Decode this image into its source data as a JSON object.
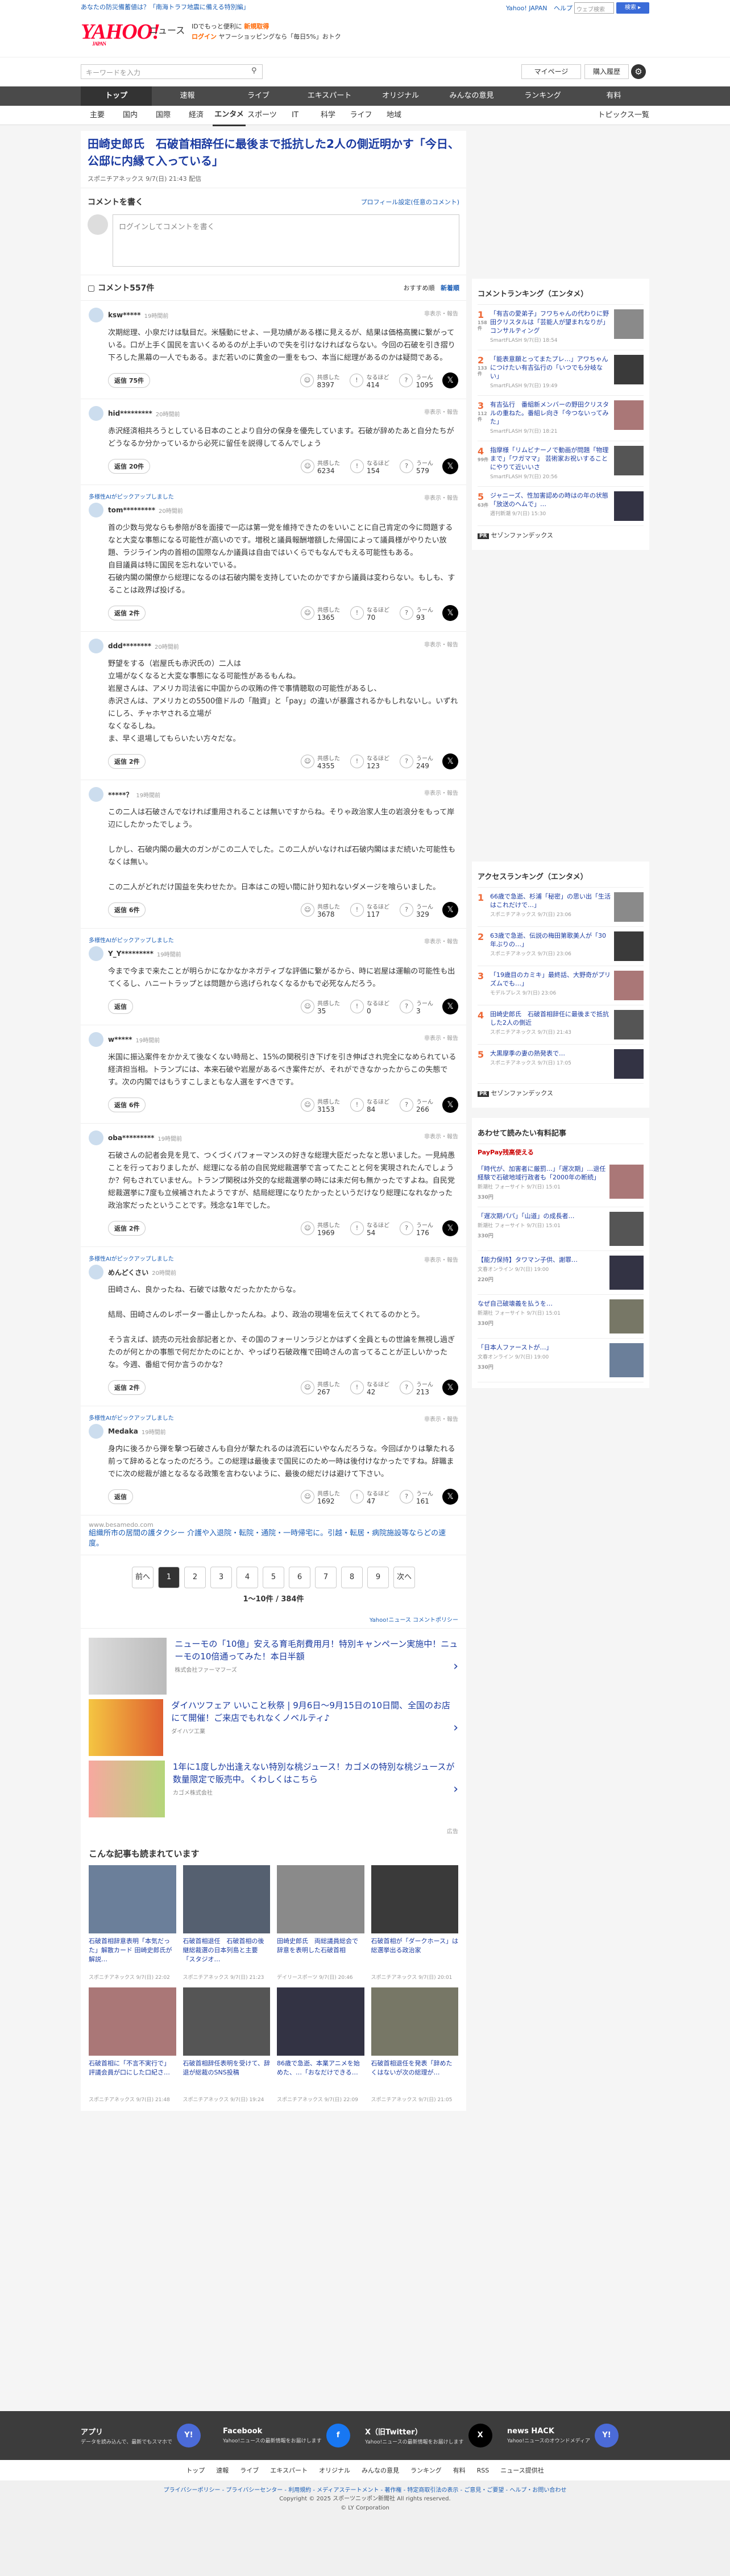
{
  "header": {
    "promo": "あなたの防災備蓄値は？「南海トラフ地震に備える特別編」",
    "links": [
      "Yahoo! JAPAN",
      "ヘルプ"
    ],
    "search_placeholder": "ウェブ検索",
    "search_button": "検索 ▸",
    "logo": "YAHOO!",
    "logo_sub": "JAPAN",
    "logo_news": "ニュース",
    "tagline1_pre": "IDでもっと便利に",
    "tagline1_link": "新規取得",
    "tagline2_pre": "ログイン",
    "tagline2_text": "ヤフーショッピングなら「毎日5%」おトク",
    "news_search_placeholder": "キーワードを入力",
    "mypage": "マイページ",
    "buy": "購入履歴"
  },
  "global_nav": [
    "トップ",
    "速報",
    "ライブ",
    "エキスパート",
    "オリジナル",
    "みんなの意見",
    "ランキング",
    "有料"
  ],
  "global_nav_active": 0,
  "sub_nav": [
    "主要",
    "国内",
    "国際",
    "経済",
    "エンタメ",
    "スポーツ",
    "IT",
    "科学",
    "ライフ",
    "地域"
  ],
  "sub_nav_active": 4,
  "sub_nav_topics": "トピックス一覧",
  "article": {
    "title": "田崎史郎氏　石破首相辞任に最後まで抵抗した2人の側近明かす「今日、公邸に内縁て入っている」",
    "meta": "スポニチアネックス  9/7(日) 21:43 配信"
  },
  "comment_write": {
    "title": "コメントを書く",
    "profile": "プロフィール設定(任意のコメント)",
    "placeholder": "ログインしてコメントを書く"
  },
  "comment_header": {
    "count": "コメント557件",
    "sort1": "おすすめ順",
    "sort2": "新着順"
  },
  "comments": [
    {
      "pick": "",
      "user": "ksw*****",
      "time": "19時間前",
      "report": "非表示・報告",
      "text": "次期総理、小泉だけは駄目だ。米騒動にせよ、一見功績がある様に見えるが、結果は価格高騰に繋がっている。口が上手く国民を言いくるめるのが上手いので失を引けなければならない。今回の石破を引き摺り下ろした黒幕の一人でもある。まだ若いのに黄金の一重をもつ、本当に総理があるのかは疑問である。",
      "reply": "返信 75件",
      "agree": "8397",
      "good": "414",
      "bad": "1095"
    },
    {
      "pick": "",
      "user": "hid*********",
      "time": "20時間前",
      "report": "非表示・報告",
      "text": "赤沢経済相共ろうとしている日本のことより自分の保身を優先しています。石破が辞めたあと自分たちがどうなるか分かっているから必死に留任を説得してるんでしょう",
      "reply": "返信 20件",
      "agree": "6234",
      "good": "154",
      "bad": "579"
    },
    {
      "pick": "多様性AIがピックアップしました",
      "user": "tom*********",
      "time": "20時間前",
      "report": "非表示・報告",
      "text": "首の少数与党ならも参陪が8を面接で一応は第一党を維持できたのをいいことに自己肯定の今に問題するなと大変な事態になる可能性が高いのです。増税と議員報酬増額した帰国によって議員様がやりたい放題、ラジライン内の首相の国際なんか議員は自由ではいくらでもなんでもえる可能性もある。\n自目議員は特に国民を忘れないでいる。\n石破内閣の閣僚から総理になるのは石破内閣を支持していたのかですから議員は変わらない。もしも、することは政界ば投げる。",
      "reply": "返信 2件",
      "agree": "1365",
      "good": "70",
      "bad": "93"
    },
    {
      "pick": "",
      "user": "ddd********",
      "time": "20時間前",
      "report": "非表示・報告",
      "text": "野望をする（岩屋氏も赤沢氏の）二人は\n立場がなくなると大変な事態になる可能性があるもんね。\n岩屋さんは、アメリカ司法省に中国からの収賄の件で事情聴取の可能性があるし、\n赤沢さんは、アメリカとの5500億ドルの「融資」と「pay」の違いが暴露されるかもしれないし。いずれにしろ、チャホヤされる立場が\nなくなるしね。\nま、早く退場してもらいたい方々だな。",
      "reply": "返信 2件",
      "agree": "4355",
      "good": "123",
      "bad": "249"
    },
    {
      "pick": "",
      "user": "*****？",
      "time": "19時間前",
      "report": "非表示・報告",
      "text": "この二人は石破さんでなければ重用されることは無いですからね。そりゃ政治家人生の岩浪分をもって岸辺にしたかったでしょう。\n\nしかし、石破内閣の最大のガンがこの二人でした。この二人がいなければ石破内閣はまだ続いた可能性もなくは無い。\n\nこの二人がどれだけ国益を失わせたか。日本はこの短い間に計り知れないダメージを喰らいました。",
      "reply": "返信 6件",
      "agree": "3678",
      "good": "117",
      "bad": "329"
    },
    {
      "pick": "多様性AIがピックアップしました",
      "user": "Y_Y*********",
      "time": "19時間前",
      "report": "非表示・報告",
      "text": "今まで今まで来たことが明らかになかなかネガティブな評価に繋がるから、時に岩屋は運輸の可能性も出てくるし、ハニートラップとは問題から逃げられなくなるかもで必死なんだろう。",
      "reply": "返信",
      "agree": "35",
      "good": "0",
      "bad": "3"
    },
    {
      "pick": "",
      "user": "w*****",
      "time": "19時間前",
      "report": "非表示・報告",
      "text": "米国に振込案件をかかえて後なくない時局と、15%の関税引き下げを引き伸ばされ完全になめられている経済担当相。トランプには、本来石破や岩屋があるべき案件だが、それができなかったからこの失態です。次の内閣ではもうすこしまともな人選をすべきです。",
      "reply": "返信 6件",
      "agree": "3153",
      "good": "84",
      "bad": "266"
    },
    {
      "pick": "",
      "user": "oba*********",
      "time": "19時間前",
      "report": "非表示・報告",
      "text": "石破さんの記者会見を見て、つくづくパフォーマンスの好きな総理大臣だったなと思いました。一見純愚ことを行っておりましたが、総理になる前の自民党総裁選挙で言ってたことと何を実現されたんでしょうか？何もされていません。トランプ関税は外交的な総裁選挙の時には未だ何も無かったですよね。自民党総裁選挙に7度も立候補されたようですが、結局総理になりたかったというだけなり総理になれなかった政治家だったということです。残念な1年でした。",
      "reply": "返信 2件",
      "agree": "1969",
      "good": "54",
      "bad": "176"
    },
    {
      "pick": "多様性AIがピックアップしました",
      "user": "めんどくさい",
      "time": "20時間前",
      "report": "非表示・報告",
      "text": "田崎さん、良かったね、石破では散々だったかたからな。\n\n結局、田崎さんのレポーター番止しかったんね。より、政治の現場を伝えてくれてるのかとう。\n\nそう言えば、読売の元社会部記者とか、その国のフォーリンラジとかはずく全員ともの世論を無視し過ぎたのが何とかの事態で何だかたのにとか、やっぱり石破政権で田崎さんの言ってることが正しいかったな。今週、番組で何か言うのかな？",
      "reply": "返信 2件",
      "agree": "267",
      "good": "42",
      "bad": "213"
    },
    {
      "pick": "多様性AIがピックアップしました",
      "user": "Medaka",
      "time": "19時間前",
      "report": "非表示・報告",
      "text": "身内に後ろから弾を撃つ石破さんも自分が撃たれるのは流石にいやなんだろうな。今回ばかりは撃たれる前って辞めるとなったのだろう。この総理は最後まで国民にのため一時は後付けなかったですね。辞職までに次の総裁が誰となるなる政策を言わないように、最後の総だけは避けて下さい。",
      "reply": "返信",
      "agree": "1692",
      "good": "47",
      "bad": "161"
    }
  ],
  "vote_labels": {
    "agree": "共感した",
    "good": "なるほど",
    "bad": "うーん"
  },
  "inline_ad": {
    "url": "www.besamedo.com",
    "text": "組織所市の居間の護タクシー 介護や入退院・転院・通院・一時帰宅に。引越・転居・病院施設等ならどの速度。"
  },
  "pager": {
    "prev": "前へ",
    "pages": [
      "1",
      "2",
      "3",
      "4",
      "5",
      "6",
      "7",
      "8",
      "9"
    ],
    "next": "次へ",
    "count": "1〜10件 / 384件",
    "policy": "Yahoo!ニュース コメントポリシー"
  },
  "ads": [
    {
      "title": "ニューモの「10億」安える育毛剤費用月！特別キャンペーン実施中！ニューモの10倍通ってみた！本日半額",
      "sponsor": "株式会社ファーマフーズ"
    },
    {
      "title": "ダイハツフェア いいこと秋祭 | 9月6日〜9月15日の10日間、全国のお店にて開催！ご来店でもれなくノベルティ♪",
      "sponsor": "ダイハツ工業"
    },
    {
      "title": "1年に1度しか出逢えない特別な桃ジュース！カゴメの特別な桃ジュースが数量限定で販売中。くわしくはこちら",
      "sponsor": "カゴメ株式会社"
    }
  ],
  "ads_label": "広告",
  "reads": {
    "title": "こんな記事も読まれています",
    "items": [
      {
        "t": "石破首相辞意表明「本気だった」解散カード 田崎史郎氏が解説…",
        "s": "スポニチアネックス 9/7(日) 22:02"
      },
      {
        "t": "石破首相退任　石破首相の後継総裁選の日本列島と主要 「スタジオ…",
        "s": "スポニチアネックス 9/7(日) 21:23"
      },
      {
        "t": "田崎史郎氏　両総議員総会で辞意を表明した石破首相",
        "s": "デイリースポーツ 9/7(日) 20:46"
      },
      {
        "t": "石破首相が「ダークホース」は総選挙出る政治家",
        "s": "スポニチアネックス 9/7(日) 20:01"
      },
      {
        "t": "石破首相に「不言不実行で」評議会員が口にした口紀さ…",
        "s": "スポニチアネックス 9/7(日) 21:48"
      },
      {
        "t": "石破首相辞任表明を受けて、辞退が総裁のSNS投稿",
        "s": "スポニチアネックス 9/7(日) 19:24"
      },
      {
        "t": "86歳で急逝、本業アニメを始めた、…「おなだけできる…",
        "s": "スポニチアネックス 9/7(日) 22:09"
      },
      {
        "t": "石破首相退任を発表「辞めたくはないが次の総理が…",
        "s": "スポニチアネックス 9/7(日) 21:05"
      }
    ]
  },
  "ranking1": {
    "title": "コメントランキング（エンタメ）",
    "items": [
      {
        "no": "1",
        "n": "158件",
        "t": "「有吉の愛弟子」フワちゃんの代わりに野田クリスタルは「芸能人が望まれなりが」 コンサルティング",
        "s": "SmartFLASH 9/7(日) 18:54"
      },
      {
        "no": "2",
        "n": "133件",
        "t": "「能表意願とってまたプレ…」アワちゃんにつけたい有吉弘行の「いつでも分岐ない」",
        "s": "SmartFLASH 9/7(日) 19:49"
      },
      {
        "no": "3",
        "n": "112件",
        "t": "有吉弘行　番組新メンバーの野田クリスタルの重ねた。番組レ向き「今つないってみた」",
        "s": "SmartFLASH 9/7(日) 18:21"
      },
      {
        "no": "4",
        "n": "99件",
        "t": "指摩様「リムビナーノで動画が問題「物理まで」「ワガママ」 芸術家お祝いすることにやりて近いいさ",
        "s": "SmartFLASH 9/7(日) 20:56"
      },
      {
        "no": "5",
        "n": "63件",
        "t": "ジャニーズ、性加害認めの時はの年の状態「放送のヘムで」…",
        "s": "週刊新潮 9/7(日) 15:30"
      }
    ],
    "pr": "セゾンファンデックス"
  },
  "ranking2": {
    "title": "アクセスランキング（エンタメ）",
    "items": [
      {
        "no": "1",
        "t": "66歳で急逝、杉浦「秘密」の思い出「生活はこれだけで…」",
        "s": "スポニチアネックス 9/7(日) 23:06"
      },
      {
        "no": "2",
        "t": "63歳で急逝、伝説の梅田第歌美人が「30年ぶりの…」",
        "s": "スポニチアネックス 9/7(日) 23:06"
      },
      {
        "no": "3",
        "t": "「19歳目のカミキ」最終話、大野奇がプリズムでも…」",
        "s": "モデルプレス 9/7(日) 23:06"
      },
      {
        "no": "4",
        "t": "田崎史郎氏　石破首相辞任に最後まで抵抗した2人の側近",
        "s": "スポニチアネックス 9/7(日) 21:43"
      },
      {
        "no": "5",
        "t": "大黒摩季の妻の熱発表で…",
        "s": "スポニチアネックス 9/7(日) 17:05"
      }
    ],
    "pr": "セゾンファンデックス"
  },
  "paypay": {
    "title": "あわせて読みたい有料記事",
    "label": "PayPay残高使える",
    "items": [
      {
        "t": "「時代が、加害者に厳罰…」「遅次期」…退任経験で石破地域行政者も「2000年の断続」",
        "s": "新潮社 フォーサイト 9/7(日) 15:01",
        "p": "330円"
      },
      {
        "t": "「遅次期パパ」「山道」の成長者…",
        "s": "新潮社 フォーサイト 9/7(日) 15:01",
        "p": "330円"
      },
      {
        "t": "【能力保持】タワマン子供、謝罪…",
        "s": "文春オンライン 9/7(日) 19:00",
        "p": "220円"
      },
      {
        "t": "なぜ自己破壊義を払うを…",
        "s": "新潮社 フォーサイト 9/7(日) 15:01",
        "p": "330円"
      },
      {
        "t": "「日本人ファーストが…」",
        "s": "文春オンライン 9/7(日) 19:00",
        "p": "330円"
      }
    ]
  },
  "footer": {
    "items": [
      {
        "h": "アプリ",
        "d": "データを読み込んで、最新でもスマホで",
        "ic": "Y!"
      },
      {
        "h": "Facebook",
        "d": "Yahoo!ニュースの最新情報をお届けします",
        "ic": "f"
      },
      {
        "h": "X（旧Twitter）",
        "d": "Yahoo!ニュースの最新情報をお届けします",
        "ic": "X"
      },
      {
        "h": "news HACK",
        "d": "Yahoo!ニュースのオウンドメディア",
        "ic": "Y!"
      }
    ],
    "nav": [
      "トップ",
      "速報",
      "ライブ",
      "エキスパート",
      "オリジナル",
      "みんなの意見",
      "ランキング",
      "有料",
      "RSS",
      "ニュース提供社"
    ],
    "links": "プライバシーポリシー - プライバシーセンター - 利用規約 - メディアステートメント - 著作権 - 特定商取引法の表示 - ご意見・ご要望 - ヘルプ・お問い合わせ",
    "copy1": "Copyright © 2025 スポーツニッポン新聞社 All rights reserved.",
    "copy2": "© LY Corporation"
  }
}
